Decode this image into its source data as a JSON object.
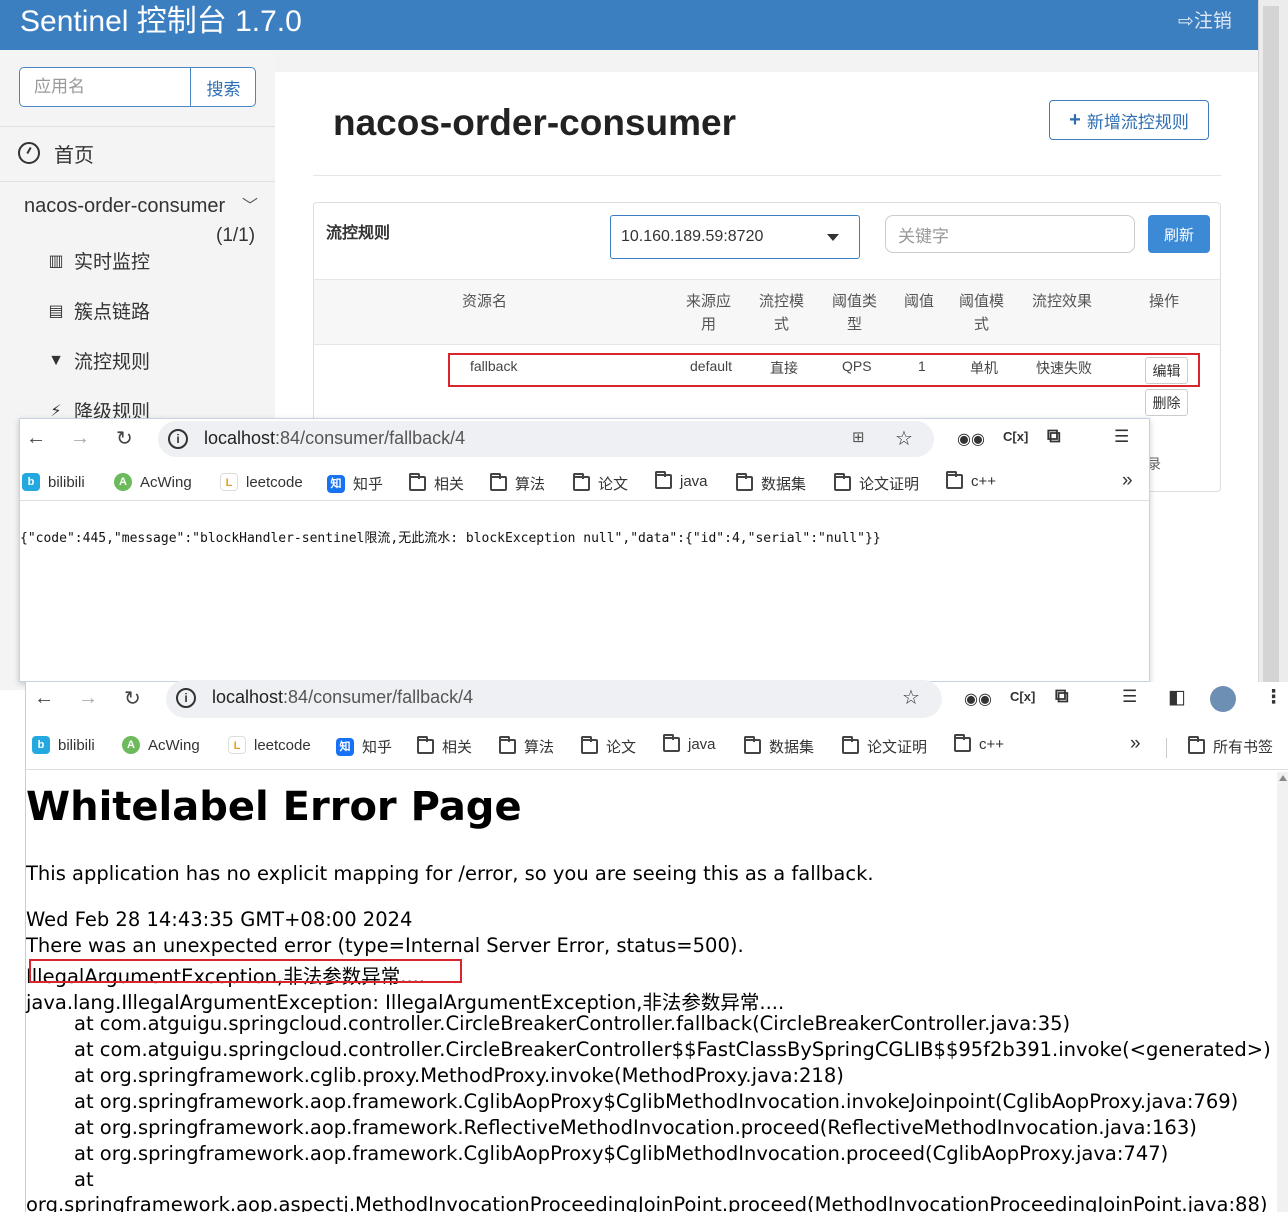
{
  "sentinel": {
    "brand": "Sentinel 控制台 1.7.0",
    "logout": "注销",
    "search_placeholder": "应用名",
    "search_button": "搜索",
    "home": "首页",
    "app_name": "nacos-order-consumer",
    "app_count": "(1/1)",
    "menu": [
      {
        "label": "实时监控",
        "icon": "bar-chart-icon"
      },
      {
        "label": "簇点链路",
        "icon": "list-icon"
      },
      {
        "label": "流控规则",
        "icon": "filter-icon"
      },
      {
        "label": "降级规则",
        "icon": "flash-icon"
      }
    ],
    "page_title": "nacos-order-consumer",
    "add_rule": "新增流控规则",
    "panel_title": "流控规则",
    "ip_selected": "10.160.189.59:8720",
    "keyword_placeholder": "关键字",
    "refresh": "刷新",
    "columns": [
      "资源名",
      "来源应用",
      "流控模式",
      "阈值类型",
      "阈值",
      "阈值模式",
      "流控效果",
      "操作"
    ],
    "columns_wrapped": {
      "source_app": [
        "来源应",
        "用"
      ],
      "flow_mode": [
        "流控模",
        "式"
      ],
      "threshold_type": [
        "阈值类",
        "型"
      ],
      "threshold_mode": [
        "阈值模",
        "式"
      ]
    },
    "row": {
      "resource": "fallback",
      "source": "default",
      "mode": "直接",
      "type": "QPS",
      "threshold": "1",
      "cluster": "单机",
      "effect": "快速失败",
      "edit": "编辑",
      "delete": "删除"
    },
    "partial_text": "录",
    "accent_color": "#3c7fc1",
    "highlight_color": "#d8262f"
  },
  "browser1": {
    "url_host": "localhost",
    "url_path": ":84/consumer/fallback/4",
    "bookmarks": [
      "bilibili",
      "AcWing",
      "leetcode",
      "知乎",
      "相关",
      "算法",
      "论文",
      "java",
      "数据集",
      "论文证明",
      "c++"
    ],
    "more": "»",
    "body": "{\"code\":445,\"message\":\"blockHandler-sentinel限流,无此流水: blockException  null\",\"data\":{\"id\":4,\"serial\":\"null\"}}"
  },
  "browser2": {
    "url_host": "localhost",
    "url_path": ":84/consumer/fallback/4",
    "bookmarks": [
      "bilibili",
      "AcWing",
      "leetcode",
      "知乎",
      "相关",
      "算法",
      "论文",
      "java",
      "数据集",
      "论文证明",
      "c++"
    ],
    "more": "»",
    "all_bookmarks": "所有书签",
    "title": "Whitelabel Error Page",
    "intro": "This application has no explicit mapping for /error, so you are seeing this as a fallback.",
    "timestamp": "Wed Feb 28 14:43:35 GMT+08:00 2024",
    "error_line": "There was an unexpected error (type=Internal Server Error, status=500).",
    "message": "IllegalArgumentException,非法参数异常....",
    "exception": "java.lang.IllegalArgumentException: IllegalArgumentException,非法参数异常....",
    "stack": [
      "at com.atguigu.springcloud.controller.CircleBreakerController.fallback(CircleBreakerController.java:35)",
      "at com.atguigu.springcloud.controller.CircleBreakerController$$FastClassBySpringCGLIB$$95f2b391.invoke(<generated>)",
      "at org.springframework.cglib.proxy.MethodProxy.invoke(MethodProxy.java:218)",
      "at org.springframework.aop.framework.CglibAopProxy$CglibMethodInvocation.invokeJoinpoint(CglibAopProxy.java:769)",
      "at org.springframework.aop.framework.ReflectiveMethodInvocation.proceed(ReflectiveMethodInvocation.java:163)",
      "at org.springframework.aop.framework.CglibAopProxy$CglibMethodInvocation.proceed(CglibAopProxy.java:747)",
      "at"
    ],
    "stack_tail": "org.springframework.aop.aspectj.MethodInvocationProceedingJoinPoint.proceed(MethodInvocationProceedingJoinPoint.java:88)"
  }
}
